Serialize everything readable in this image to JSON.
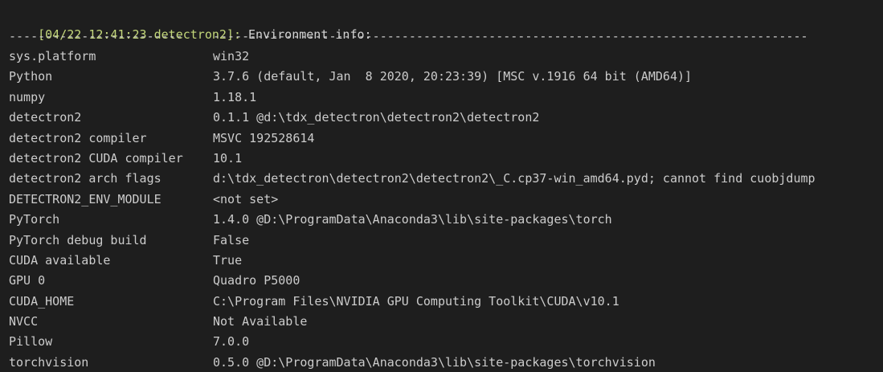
{
  "log": {
    "prefix": "[04/22 12:41:23 detectron2]:",
    "message": " Environment info:"
  },
  "separator": {
    "left": "------------------------",
    "right": "----------------------------------------------------------------------------------"
  },
  "rows": [
    {
      "key": "sys.platform",
      "value": "win32"
    },
    {
      "key": "Python",
      "value": "3.7.6 (default, Jan  8 2020, 20:23:39) [MSC v.1916 64 bit (AMD64)]"
    },
    {
      "key": "numpy",
      "value": "1.18.1"
    },
    {
      "key": "detectron2",
      "value": "0.1.1 @d:\\tdx_detectron\\detectron2\\detectron2"
    },
    {
      "key": "detectron2 compiler",
      "value": "MSVC 192528614"
    },
    {
      "key": "detectron2 CUDA compiler",
      "value": "10.1"
    },
    {
      "key": "detectron2 arch flags",
      "value": "d:\\tdx_detectron\\detectron2\\detectron2\\_C.cp37-win_amd64.pyd; cannot find cuobjdump"
    },
    {
      "key": "DETECTRON2_ENV_MODULE",
      "value": "<not set>"
    },
    {
      "key": "PyTorch",
      "value": "1.4.0 @D:\\ProgramData\\Anaconda3\\lib\\site-packages\\torch"
    },
    {
      "key": "PyTorch debug build",
      "value": "False"
    },
    {
      "key": "CUDA available",
      "value": "True"
    },
    {
      "key": "GPU 0",
      "value": "Quadro P5000"
    },
    {
      "key": "CUDA_HOME",
      "value": "C:\\Program Files\\NVIDIA GPU Computing Toolkit\\CUDA\\v10.1"
    },
    {
      "key": "NVCC",
      "value": "Not Available"
    },
    {
      "key": "Pillow",
      "value": "7.0.0"
    },
    {
      "key": "torchvision",
      "value": "0.5.0 @D:\\ProgramData\\Anaconda3\\lib\\site-packages\\torchvision"
    }
  ]
}
